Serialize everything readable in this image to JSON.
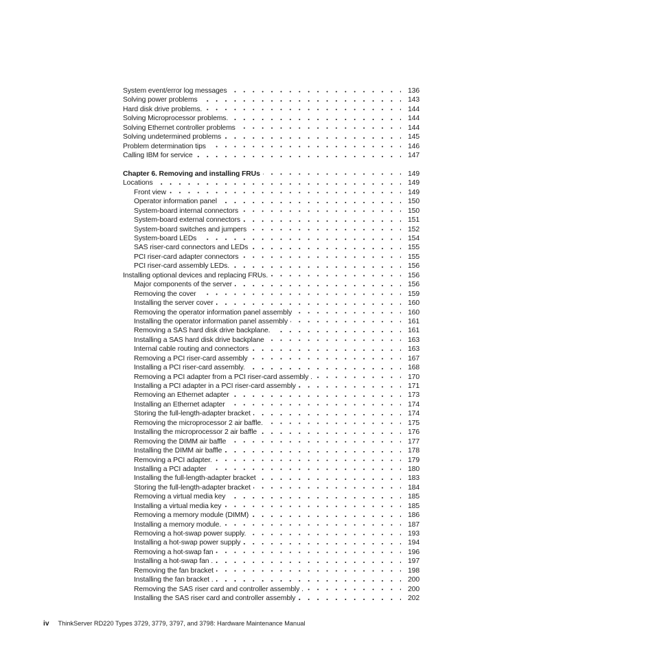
{
  "document": {
    "type": "table-of-contents",
    "footer": {
      "folio": "iv",
      "book_title": "ThinkServer RD220 Types 3729, 3779, 3797, and 3798:  Hardware Maintenance Manual"
    }
  },
  "toc": {
    "entries": [
      {
        "label": "System event/error log messages",
        "page": "136",
        "level": 0,
        "chapter": false,
        "gap_before": false
      },
      {
        "label": "Solving power problems",
        "page": "143",
        "level": 0,
        "chapter": false,
        "gap_before": false
      },
      {
        "label": "Hard disk drive problems.",
        "page": "144",
        "level": 0,
        "chapter": false,
        "gap_before": false
      },
      {
        "label": "Solving Microprocessor problems.",
        "page": "144",
        "level": 0,
        "chapter": false,
        "gap_before": false
      },
      {
        "label": "Solving Ethernet controller problems",
        "page": "144",
        "level": 0,
        "chapter": false,
        "gap_before": false
      },
      {
        "label": "Solving undetermined problems",
        "page": "145",
        "level": 0,
        "chapter": false,
        "gap_before": false
      },
      {
        "label": "Problem determination tips",
        "page": "146",
        "level": 0,
        "chapter": false,
        "gap_before": false
      },
      {
        "label": "Calling IBM for service",
        "page": "147",
        "level": 0,
        "chapter": false,
        "gap_before": false
      },
      {
        "label": "Chapter 6. Removing and installing FRUs",
        "page": "149",
        "level": 0,
        "chapter": true,
        "gap_before": true
      },
      {
        "label": "Locations",
        "page": "149",
        "level": 0,
        "chapter": false,
        "gap_before": false
      },
      {
        "label": "Front view",
        "page": "149",
        "level": 1,
        "chapter": false,
        "gap_before": false
      },
      {
        "label": "Operator information panel",
        "page": "150",
        "level": 1,
        "chapter": false,
        "gap_before": false
      },
      {
        "label": "System-board internal connectors",
        "page": "150",
        "level": 1,
        "chapter": false,
        "gap_before": false
      },
      {
        "label": "System-board external connectors",
        "page": "151",
        "level": 1,
        "chapter": false,
        "gap_before": false
      },
      {
        "label": "System-board switches and jumpers",
        "page": "152",
        "level": 1,
        "chapter": false,
        "gap_before": false
      },
      {
        "label": "System-board LEDs",
        "page": "154",
        "level": 1,
        "chapter": false,
        "gap_before": false
      },
      {
        "label": "SAS riser-card connectors and LEDs",
        "page": "155",
        "level": 1,
        "chapter": false,
        "gap_before": false
      },
      {
        "label": "PCI riser-card adapter connectors",
        "page": "155",
        "level": 1,
        "chapter": false,
        "gap_before": false
      },
      {
        "label": "PCI riser-card assembly LEDs.",
        "page": "156",
        "level": 1,
        "chapter": false,
        "gap_before": false
      },
      {
        "label": "Installing optional devices and replacing FRUs.",
        "page": "156",
        "level": 0,
        "chapter": false,
        "gap_before": false
      },
      {
        "label": "Major components of the server",
        "page": "156",
        "level": 1,
        "chapter": false,
        "gap_before": false
      },
      {
        "label": "Removing the cover",
        "page": "159",
        "level": 1,
        "chapter": false,
        "gap_before": false
      },
      {
        "label": "Installing the server cover",
        "page": "160",
        "level": 1,
        "chapter": false,
        "gap_before": false
      },
      {
        "label": "Removing the operator information panel assembly",
        "page": "160",
        "level": 1,
        "chapter": false,
        "gap_before": false
      },
      {
        "label": "Installing the operator information panel assembly",
        "page": "161",
        "level": 1,
        "chapter": false,
        "gap_before": false
      },
      {
        "label": "Removing a SAS hard disk drive backplane.",
        "page": "161",
        "level": 1,
        "chapter": false,
        "gap_before": false
      },
      {
        "label": "Installing a SAS hard disk drive backplane",
        "page": "163",
        "level": 1,
        "chapter": false,
        "gap_before": false
      },
      {
        "label": "Internal cable routing and connectors",
        "page": "163",
        "level": 1,
        "chapter": false,
        "gap_before": false
      },
      {
        "label": "Removing a PCI riser-card assembly",
        "page": "167",
        "level": 1,
        "chapter": false,
        "gap_before": false
      },
      {
        "label": "Installing a PCI riser-card assembly.",
        "page": "168",
        "level": 1,
        "chapter": false,
        "gap_before": false
      },
      {
        "label": "Removing a PCI adapter from a PCI riser-card assembly .",
        "page": "170",
        "level": 1,
        "chapter": false,
        "gap_before": false
      },
      {
        "label": "Installing a PCI adapter in a PCI riser-card assembly",
        "page": "171",
        "level": 1,
        "chapter": false,
        "gap_before": false
      },
      {
        "label": "Removing an Ethernet adapter",
        "page": "173",
        "level": 1,
        "chapter": false,
        "gap_before": false
      },
      {
        "label": "Installing an Ethernet adapter",
        "page": "174",
        "level": 1,
        "chapter": false,
        "gap_before": false
      },
      {
        "label": "Storing the full-length-adapter bracket",
        "page": "174",
        "level": 1,
        "chapter": false,
        "gap_before": false
      },
      {
        "label": "Removing the microprocessor 2 air baffle.",
        "page": "175",
        "level": 1,
        "chapter": false,
        "gap_before": false
      },
      {
        "label": "Installing the microprocessor 2 air baffle",
        "page": "176",
        "level": 1,
        "chapter": false,
        "gap_before": false
      },
      {
        "label": "Removing the DIMM air baffle",
        "page": "177",
        "level": 1,
        "chapter": false,
        "gap_before": false
      },
      {
        "label": "Installing the DIMM air baffle",
        "page": "178",
        "level": 1,
        "chapter": false,
        "gap_before": false
      },
      {
        "label": "Removing a PCI adapter.",
        "page": "179",
        "level": 1,
        "chapter": false,
        "gap_before": false
      },
      {
        "label": "Installing a PCI adapter",
        "page": "180",
        "level": 1,
        "chapter": false,
        "gap_before": false
      },
      {
        "label": "Installing the full-length-adapter bracket",
        "page": "183",
        "level": 1,
        "chapter": false,
        "gap_before": false
      },
      {
        "label": "Storing the full-length-adapter bracket",
        "page": "184",
        "level": 1,
        "chapter": false,
        "gap_before": false
      },
      {
        "label": "Removing a virtual media key",
        "page": "185",
        "level": 1,
        "chapter": false,
        "gap_before": false
      },
      {
        "label": "Installing a virtual media key",
        "page": "185",
        "level": 1,
        "chapter": false,
        "gap_before": false
      },
      {
        "label": "Removing a memory module (DIMM)",
        "page": "186",
        "level": 1,
        "chapter": false,
        "gap_before": false
      },
      {
        "label": "Installing a memory module.",
        "page": "187",
        "level": 1,
        "chapter": false,
        "gap_before": false
      },
      {
        "label": "Removing a hot-swap power supply.",
        "page": "193",
        "level": 1,
        "chapter": false,
        "gap_before": false
      },
      {
        "label": "Installing a hot-swap power supply",
        "page": "194",
        "level": 1,
        "chapter": false,
        "gap_before": false
      },
      {
        "label": "Removing a hot-swap fan",
        "page": "196",
        "level": 1,
        "chapter": false,
        "gap_before": false
      },
      {
        "label": "Installing a hot-swap fan .",
        "page": "197",
        "level": 1,
        "chapter": false,
        "gap_before": false
      },
      {
        "label": "Removing the fan bracket",
        "page": "198",
        "level": 1,
        "chapter": false,
        "gap_before": false
      },
      {
        "label": "Installing the fan bracket .",
        "page": "200",
        "level": 1,
        "chapter": false,
        "gap_before": false
      },
      {
        "label": "Removing the SAS riser card and controller assembly .",
        "page": "200",
        "level": 1,
        "chapter": false,
        "gap_before": false
      },
      {
        "label": "Installing the SAS riser card and controller assembly",
        "page": "202",
        "level": 1,
        "chapter": false,
        "gap_before": false
      }
    ]
  }
}
